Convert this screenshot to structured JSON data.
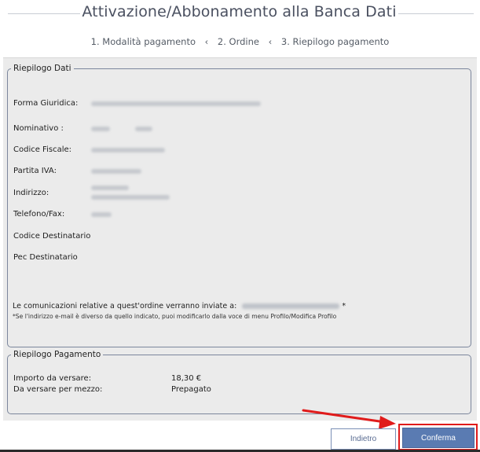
{
  "page": {
    "title": "Attivazione/Abbonamento alla Banca Dati"
  },
  "steps": [
    {
      "label": "1. Modalità pagamento"
    },
    {
      "label": "2. Ordine"
    },
    {
      "label": "3. Riepilogo pagamento"
    }
  ],
  "step_separator": "‹",
  "riepilogo_dati": {
    "legend": "Riepilogo Dati",
    "fields": [
      {
        "label": "Forma Giuridica:"
      },
      {
        "label": "Nominativo :"
      },
      {
        "label": "Codice Fiscale:"
      },
      {
        "label": "Partita IVA:"
      },
      {
        "label": "Indirizzo:"
      },
      {
        "label": "Telefono/Fax:"
      },
      {
        "label": "Codice Destinatario"
      },
      {
        "label": "Pec Destinatario"
      }
    ],
    "communication_text": "Le comunicazioni relative a quest'ordine verranno inviate a:",
    "communication_asterisk": "*",
    "note": "*Se l'indirizzo e-mail è diverso da quello indicato, puoi modificarlo dalla voce di menu Profilo/Modifica Profilo"
  },
  "riepilogo_pagamento": {
    "legend": "Riepilogo Pagamento",
    "rows": [
      {
        "label": "Importo da versare:",
        "value": "18,30 €"
      },
      {
        "label": "Da versare per mezzo:",
        "value": "Prepagato"
      }
    ]
  },
  "buttons": {
    "back_label": "Indietro",
    "confirm_label": "Conferma"
  },
  "colors": {
    "highlight": "#e01b1b",
    "confirm_bg": "#5a7bb2",
    "panel_bg": "#ebebeb"
  }
}
